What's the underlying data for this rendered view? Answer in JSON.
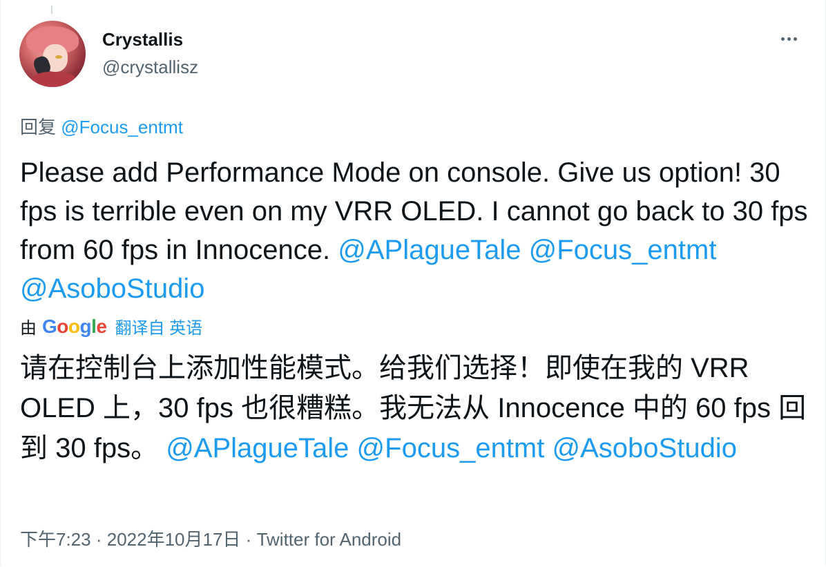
{
  "author": {
    "display_name": "Crystallis",
    "handle": "@crystallisz"
  },
  "reply": {
    "prefix": "回复",
    "mention": "@Focus_entmt"
  },
  "tweet": {
    "text": "Please add Performance Mode on console. Give us option! 30 fps is terrible even on my VRR OLED. I cannot go back to 30 fps from 60 fps in Innocence.",
    "mentions": [
      "@APlagueTale",
      "@Focus_entmt",
      "@AsoboStudio"
    ]
  },
  "translation_bar": {
    "by": "由",
    "provider": "Google",
    "translated_from": "翻译自 英语"
  },
  "translation": {
    "text": "请在控制台上添加性能模式。给我们选择！即使在我的 VRR OLED 上，30 fps 也很糟糕。我无法从 Innocence 中的 60 fps 回到 30 fps。",
    "mentions": [
      "@APlagueTale",
      "@Focus_entmt",
      "@AsoboStudio"
    ]
  },
  "meta": {
    "time": "下午7:23",
    "separator": "·",
    "date": "2022年10月17日",
    "source": "Twitter for Android"
  },
  "colors": {
    "link": "#1d9bf0",
    "secondary_text": "#536471",
    "primary_text": "#0f1419"
  },
  "icons": {
    "more": "more-horizontal-icon"
  }
}
